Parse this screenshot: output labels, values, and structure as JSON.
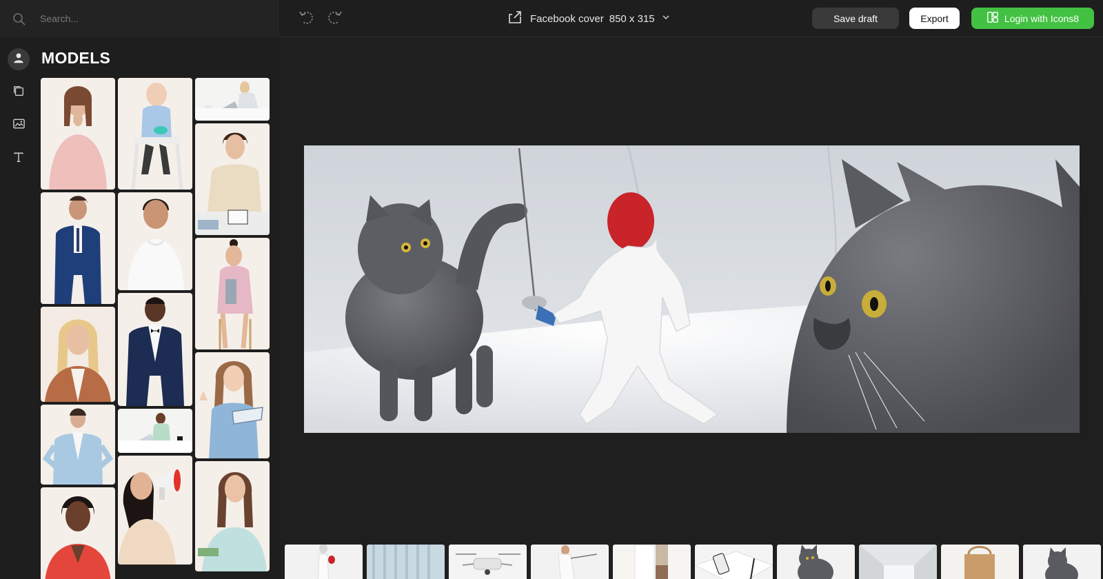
{
  "search": {
    "placeholder": "Search..."
  },
  "toolbar": {
    "undo_icon": "undo-icon",
    "redo_icon": "redo-icon",
    "format_name": "Facebook cover",
    "format_size": "850 x 315",
    "save_draft_label": "Save draft",
    "export_label": "Export",
    "login_label": "Login with Icons8"
  },
  "rail": {
    "items": [
      {
        "icon": "user-icon",
        "active": true
      },
      {
        "icon": "layers-icon",
        "active": false
      },
      {
        "icon": "image-icon",
        "active": false
      },
      {
        "icon": "text-icon",
        "active": false
      }
    ]
  },
  "panel": {
    "title": "MODELS",
    "models": [
      "woman-pink-blouse",
      "baby-high-chair",
      "woman-laptop-desk",
      "man-blue-suit",
      "man-white-sweater",
      "woman-beige-jacket",
      "woman-blonde-thinking",
      "man-tuxedo",
      "woman-pink-coat-stool",
      "woman-blue-blazer",
      "woman-desk-small",
      "girl-tablet",
      "woman-red-top",
      "woman-megaphone",
      "woman-money"
    ]
  },
  "canvas": {
    "cover_image": "cats-and-fencer-collage"
  },
  "strip": {
    "items": [
      "fencer-red-mask",
      "curtain-window",
      "white-drone",
      "fencer-lunge",
      "doorway-room",
      "phone-keyboard",
      "gray-cat",
      "white-room-corner",
      "paper-bag",
      "gray-cat-small"
    ]
  },
  "colors": {
    "accent_green": "#43c142",
    "background": "#1f1f1f",
    "panel": "#1e1e1e",
    "button_dark": "#3a3a3a"
  }
}
